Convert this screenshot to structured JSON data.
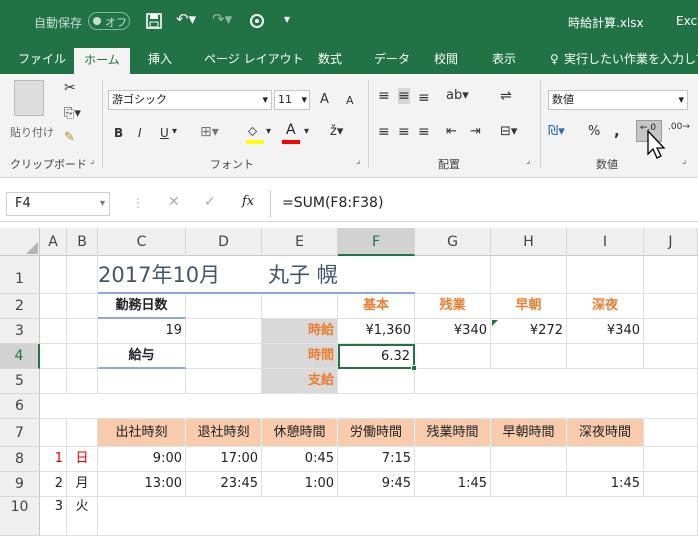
{
  "titlebar": {
    "autosave": "自動保存",
    "autosave_state": "オフ",
    "filename": "時給計算.xlsx",
    "app": "Exc"
  },
  "tabs": [
    "ファイル",
    "ホーム",
    "挿入",
    "ページ レイアウト",
    "数式",
    "データ",
    "校閲",
    "表示"
  ],
  "tellme": "実行したい作業を入力して",
  "ribbon": {
    "paste": "貼り付け",
    "clipboard": "クリップボード",
    "font_name": "游ゴシック",
    "font_size": "11",
    "font_grow": "A",
    "font_shrink": "A",
    "bold": "B",
    "italic": "I",
    "underline": "U",
    "font_color": "A",
    "font_group": "フォント",
    "align_group": "配置",
    "number_format": "数値",
    "number_group": "数値",
    "percent": "%",
    "comma": ","
  },
  "formula": {
    "namebox": "F4",
    "fx": "fx",
    "content": "=SUM(F8:F38)"
  },
  "columns": [
    "A",
    "B",
    "C",
    "D",
    "E",
    "F",
    "G",
    "H",
    "I",
    "J"
  ],
  "rows": [
    "1",
    "2",
    "3",
    "4",
    "5",
    "6",
    "7",
    "8",
    "9",
    "10"
  ],
  "sheet": {
    "c1": "2017年10月",
    "e1": "丸子 幌",
    "c2": "勤務日数",
    "c3": "19",
    "c4": "給与",
    "e3": "時給",
    "e4": "時間",
    "e5": "支給",
    "f2": "基本",
    "g2": "残業",
    "h2": "早朝",
    "i2": "深夜",
    "f3": "¥1,360",
    "g3": "¥340",
    "h3": "¥272",
    "i3": "¥340",
    "f4": "6.32",
    "headers": [
      "出社時刻",
      "退社時刻",
      "休憩時間",
      "労働時間",
      "残業時間",
      "早朝時間",
      "深夜時間"
    ],
    "r8": {
      "a": "1",
      "b": "日",
      "c": "9:00",
      "d": "17:00",
      "e": "0:45",
      "f": "7:15"
    },
    "r9": {
      "a": "2",
      "b": "月",
      "c": "13:00",
      "d": "23:45",
      "e": "1:00",
      "f": "9:45",
      "g": "1:45",
      "i": "1:45"
    },
    "r10": {
      "a": "3",
      "b": "火"
    }
  },
  "colors": {
    "excel_green": "#217346",
    "accent_orange": "#ed7d31",
    "header_fill": "#f8cbad",
    "sunday_red": "#e00000"
  }
}
